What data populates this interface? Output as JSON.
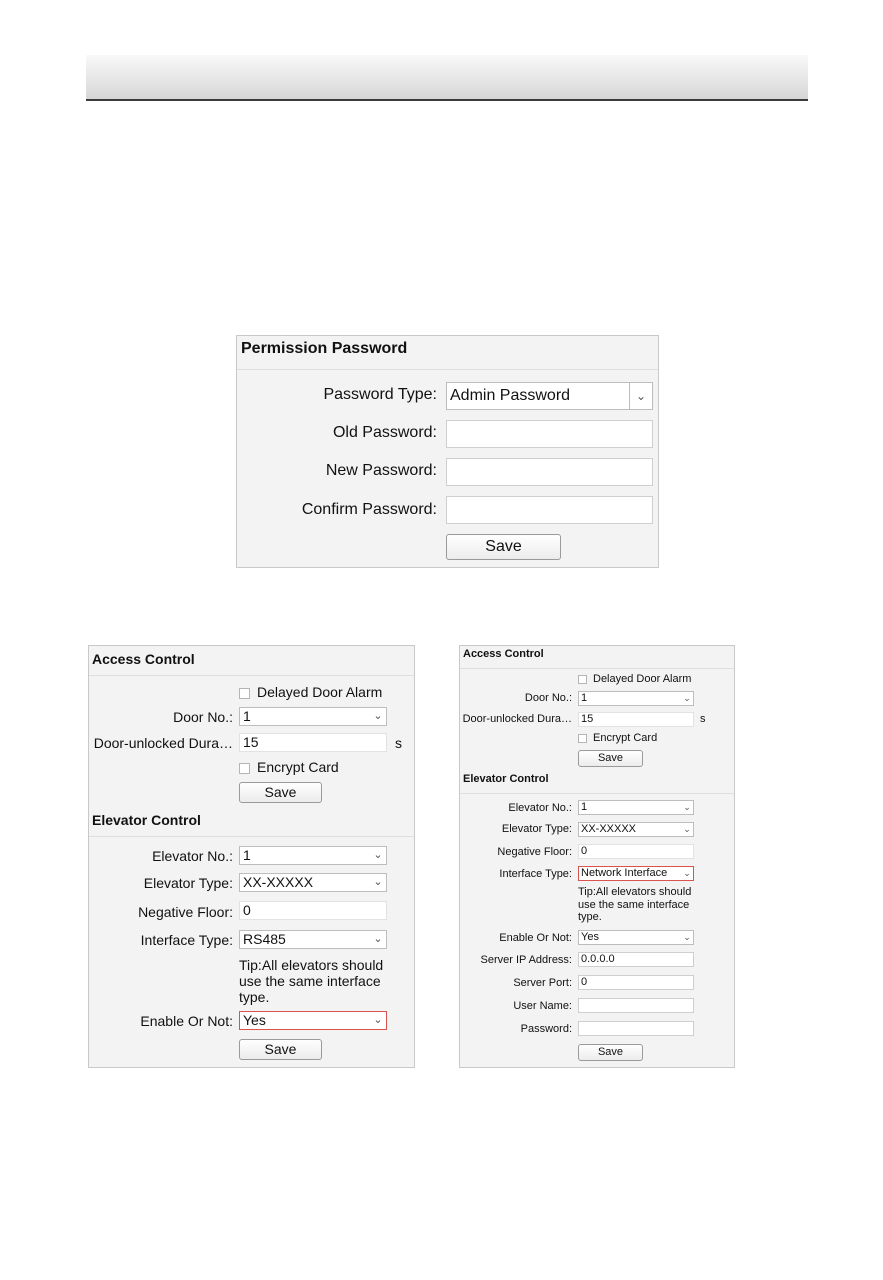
{
  "permission_panel": {
    "title": "Permission Password",
    "password_type_label": "Password Type:",
    "password_type_value": "Admin Password",
    "old_password_label": "Old Password:",
    "old_password_value": "",
    "new_password_label": "New Password:",
    "new_password_value": "",
    "confirm_password_label": "Confirm Password:",
    "confirm_password_value": "",
    "save_label": "Save"
  },
  "panel_a": {
    "access_title": "Access Control",
    "delayed_alarm_label": "Delayed Door Alarm",
    "door_no_label": "Door No.:",
    "door_no_value": "1",
    "unlock_duration_label": "Door-unlocked Dura…",
    "unlock_duration_value": "15",
    "unit_s": "s",
    "encrypt_card_label": "Encrypt Card",
    "access_save_label": "Save",
    "elevator_title": "Elevator Control",
    "elevator_no_label": "Elevator No.:",
    "elevator_no_value": "1",
    "elevator_type_label": "Elevator Type:",
    "elevator_type_value": "XX-XXXXX",
    "negative_floor_label": "Negative Floor:",
    "negative_floor_value": "0",
    "interface_type_label": "Interface Type:",
    "interface_type_value": "RS485",
    "tip": "Tip:All elevators should use the same interface type.",
    "enable_label": "Enable Or Not:",
    "enable_value": "Yes",
    "elevator_save_label": "Save"
  },
  "panel_b": {
    "access_title": "Access Control",
    "delayed_alarm_label": "Delayed Door Alarm",
    "door_no_label": "Door No.:",
    "door_no_value": "1",
    "unlock_duration_label": "Door-unlocked Dura…",
    "unlock_duration_value": "15",
    "unit_s": "s",
    "encrypt_card_label": "Encrypt Card",
    "access_save_label": "Save",
    "elevator_title": "Elevator Control",
    "elevator_no_label": "Elevator No.:",
    "elevator_no_value": "1",
    "elevator_type_label": "Elevator Type:",
    "elevator_type_value": "XX-XXXXX",
    "negative_floor_label": "Negative Floor:",
    "negative_floor_value": "0",
    "interface_type_label": "Interface Type:",
    "interface_type_value": "Network Interface",
    "tip": "Tip:All elevators should use the same interface type.",
    "enable_label": "Enable Or Not:",
    "enable_value": "Yes",
    "server_ip_label": "Server IP Address:",
    "server_ip_value": "0.0.0.0",
    "server_port_label": "Server Port:",
    "server_port_value": "0",
    "user_name_label": "User Name:",
    "user_name_value": "",
    "password_label": "Password:",
    "password_value": "",
    "elevator_save_label": "Save"
  },
  "icons": {
    "dropdown": "chevron-down-icon",
    "checkbox": "checkbox-icon"
  }
}
